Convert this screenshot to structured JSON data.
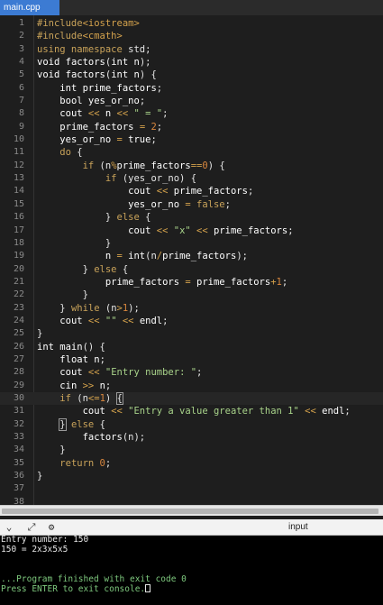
{
  "tab": {
    "title": "main.cpp"
  },
  "editor": {
    "current_line": 30,
    "lines": [
      {
        "n": "1",
        "t": [
          [
            "pp",
            "#include"
          ],
          [
            "op",
            "<iostream>"
          ]
        ]
      },
      {
        "n": "2",
        "t": [
          [
            "pp",
            "#include"
          ],
          [
            "op",
            "<cmath>"
          ]
        ]
      },
      {
        "n": "3",
        "t": [
          [
            "kw",
            "using namespace"
          ],
          [
            "pu",
            " std;"
          ]
        ]
      },
      {
        "n": "4",
        "t": [
          [
            "ty",
            "void"
          ],
          [
            "id",
            " factors"
          ],
          [
            "pu",
            "("
          ],
          [
            "ty",
            "int"
          ],
          [
            "id",
            " n"
          ],
          [
            "pu",
            ");"
          ]
        ]
      },
      {
        "n": "5",
        "t": [
          [
            "ty",
            "void"
          ],
          [
            "id",
            " factors"
          ],
          [
            "pu",
            "("
          ],
          [
            "ty",
            "int"
          ],
          [
            "id",
            " n"
          ],
          [
            "pu",
            ") {"
          ]
        ]
      },
      {
        "n": "6",
        "t": [
          [
            "pu",
            "    "
          ],
          [
            "ty",
            "int"
          ],
          [
            "id",
            " prime_factors"
          ],
          [
            "pu",
            ";"
          ]
        ]
      },
      {
        "n": "7",
        "t": [
          [
            "pu",
            "    "
          ],
          [
            "ty",
            "bool"
          ],
          [
            "id",
            " yes_or_no"
          ],
          [
            "pu",
            ";"
          ]
        ]
      },
      {
        "n": "8",
        "t": [
          [
            "pu",
            "    "
          ],
          [
            "id",
            "cout "
          ],
          [
            "op",
            "<<"
          ],
          [
            "id",
            " n "
          ],
          [
            "op",
            "<<"
          ],
          [
            "st",
            " \" = \""
          ],
          [
            "pu",
            ";"
          ]
        ]
      },
      {
        "n": "9",
        "t": [
          [
            "pu",
            "    "
          ],
          [
            "id",
            "prime_factors "
          ],
          [
            "op",
            "="
          ],
          [
            "nu",
            " 2"
          ],
          [
            "pu",
            ";"
          ]
        ]
      },
      {
        "n": "10",
        "t": [
          [
            "pu",
            "    "
          ],
          [
            "id",
            "yes_or_no "
          ],
          [
            "op",
            "="
          ],
          [
            "ty",
            " true"
          ],
          [
            "pu",
            ";"
          ]
        ]
      },
      {
        "n": "11",
        "t": [
          [
            "pu",
            "    "
          ],
          [
            "kw",
            "do"
          ],
          [
            "pu",
            " {"
          ]
        ]
      },
      {
        "n": "12",
        "t": [
          [
            "pu",
            "        "
          ],
          [
            "kw",
            "if"
          ],
          [
            "pu",
            " (n"
          ],
          [
            "op",
            "%"
          ],
          [
            "id",
            "prime_factors"
          ],
          [
            "op",
            "=="
          ],
          [
            "nu",
            "0"
          ],
          [
            "pu",
            ") {"
          ]
        ]
      },
      {
        "n": "13",
        "t": [
          [
            "pu",
            "            "
          ],
          [
            "kw",
            "if"
          ],
          [
            "pu",
            " (yes_or_no) {"
          ]
        ]
      },
      {
        "n": "14",
        "t": [
          [
            "pu",
            "                "
          ],
          [
            "id",
            "cout "
          ],
          [
            "op",
            "<<"
          ],
          [
            "id",
            " prime_factors"
          ],
          [
            "pu",
            ";"
          ]
        ]
      },
      {
        "n": "15",
        "t": [
          [
            "pu",
            "                "
          ],
          [
            "id",
            "yes_or_no "
          ],
          [
            "op",
            "="
          ],
          [
            "kw",
            " false"
          ],
          [
            "pu",
            ";"
          ]
        ]
      },
      {
        "n": "16",
        "t": [
          [
            "pu",
            "            } "
          ],
          [
            "kw",
            "else"
          ],
          [
            "pu",
            " {"
          ]
        ]
      },
      {
        "n": "17",
        "t": [
          [
            "pu",
            "                "
          ],
          [
            "id",
            "cout "
          ],
          [
            "op",
            "<<"
          ],
          [
            "st",
            " \"x\" "
          ],
          [
            "op",
            "<<"
          ],
          [
            "id",
            " prime_factors"
          ],
          [
            "pu",
            ";"
          ]
        ]
      },
      {
        "n": "18",
        "t": [
          [
            "pu",
            "            }"
          ]
        ]
      },
      {
        "n": "19",
        "t": [
          [
            "pu",
            "            "
          ],
          [
            "id",
            "n "
          ],
          [
            "op",
            "="
          ],
          [
            "ty",
            " int"
          ],
          [
            "pu",
            "(n"
          ],
          [
            "op",
            "/"
          ],
          [
            "id",
            "prime_factors"
          ],
          [
            "pu",
            ");"
          ]
        ]
      },
      {
        "n": "20",
        "t": [
          [
            "pu",
            "        } "
          ],
          [
            "kw",
            "else"
          ],
          [
            "pu",
            " {"
          ]
        ]
      },
      {
        "n": "21",
        "t": [
          [
            "pu",
            "            "
          ],
          [
            "id",
            "prime_factors "
          ],
          [
            "op",
            "="
          ],
          [
            "id",
            " prime_factors"
          ],
          [
            "op",
            "+"
          ],
          [
            "nu",
            "1"
          ],
          [
            "pu",
            ";"
          ]
        ]
      },
      {
        "n": "22",
        "t": [
          [
            "pu",
            "        }"
          ]
        ]
      },
      {
        "n": "23",
        "t": [
          [
            "pu",
            "    } "
          ],
          [
            "kw",
            "while"
          ],
          [
            "pu",
            " (n"
          ],
          [
            "op",
            ">"
          ],
          [
            "nu",
            "1"
          ],
          [
            "pu",
            ");"
          ]
        ]
      },
      {
        "n": "24",
        "t": [
          [
            "pu",
            "    "
          ],
          [
            "id",
            "cout "
          ],
          [
            "op",
            "<<"
          ],
          [
            "st",
            " \"\" "
          ],
          [
            "op",
            "<<"
          ],
          [
            "id",
            " endl"
          ],
          [
            "pu",
            ";"
          ]
        ]
      },
      {
        "n": "25",
        "t": [
          [
            "pu",
            "}"
          ]
        ]
      },
      {
        "n": "26",
        "t": [
          [
            "ty",
            "int"
          ],
          [
            "id",
            " main"
          ],
          [
            "pu",
            "() {"
          ]
        ]
      },
      {
        "n": "27",
        "t": [
          [
            "pu",
            "    "
          ],
          [
            "ty",
            "float"
          ],
          [
            "id",
            " n"
          ],
          [
            "pu",
            ";"
          ]
        ]
      },
      {
        "n": "28",
        "t": [
          [
            "pu",
            "    "
          ],
          [
            "id",
            "cout "
          ],
          [
            "op",
            "<<"
          ],
          [
            "st",
            " \"Entry number: \""
          ],
          [
            "pu",
            ";"
          ]
        ]
      },
      {
        "n": "29",
        "t": [
          [
            "pu",
            "    "
          ],
          [
            "id",
            "cin "
          ],
          [
            "op",
            ">>"
          ],
          [
            "id",
            " n"
          ],
          [
            "pu",
            ";"
          ]
        ]
      },
      {
        "n": "30",
        "t": [
          [
            "pu",
            "    "
          ],
          [
            "kw",
            "if"
          ],
          [
            "pu",
            " (n"
          ],
          [
            "op",
            "<="
          ],
          [
            "nu",
            "1"
          ],
          [
            "pu",
            ") "
          ],
          [
            "br",
            "{"
          ]
        ]
      },
      {
        "n": "31",
        "t": [
          [
            "pu",
            "        "
          ],
          [
            "id",
            "cout "
          ],
          [
            "op",
            "<<"
          ],
          [
            "st",
            " \"Entry a value greater than 1\" "
          ],
          [
            "op",
            "<<"
          ],
          [
            "id",
            " endl"
          ],
          [
            "pu",
            ";"
          ]
        ]
      },
      {
        "n": "32",
        "t": [
          [
            "pu",
            "    "
          ],
          [
            "br",
            "}"
          ],
          [
            "pu",
            " "
          ],
          [
            "kw",
            "else"
          ],
          [
            "pu",
            " {"
          ]
        ]
      },
      {
        "n": "33",
        "t": [
          [
            "pu",
            "        "
          ],
          [
            "id",
            "factors"
          ],
          [
            "pu",
            "(n);"
          ]
        ]
      },
      {
        "n": "34",
        "t": [
          [
            "pu",
            "    }"
          ]
        ]
      },
      {
        "n": "35",
        "t": [
          [
            "pu",
            "    "
          ],
          [
            "kw",
            "return"
          ],
          [
            "nu",
            " 0"
          ],
          [
            "pu",
            ";"
          ]
        ]
      },
      {
        "n": "36",
        "t": [
          [
            "pu",
            "}"
          ]
        ]
      },
      {
        "n": "37",
        "t": []
      },
      {
        "n": "38",
        "t": []
      }
    ]
  },
  "console_bar": {
    "label": "input",
    "icons": [
      "chevron-down-icon",
      "expand-icon",
      "settings-icon"
    ]
  },
  "console": {
    "lines": [
      "Entry number: 150",
      "150 = 2x3x5x5",
      "",
      "",
      "...Program finished with exit code 0",
      "Press ENTER to exit console."
    ]
  }
}
